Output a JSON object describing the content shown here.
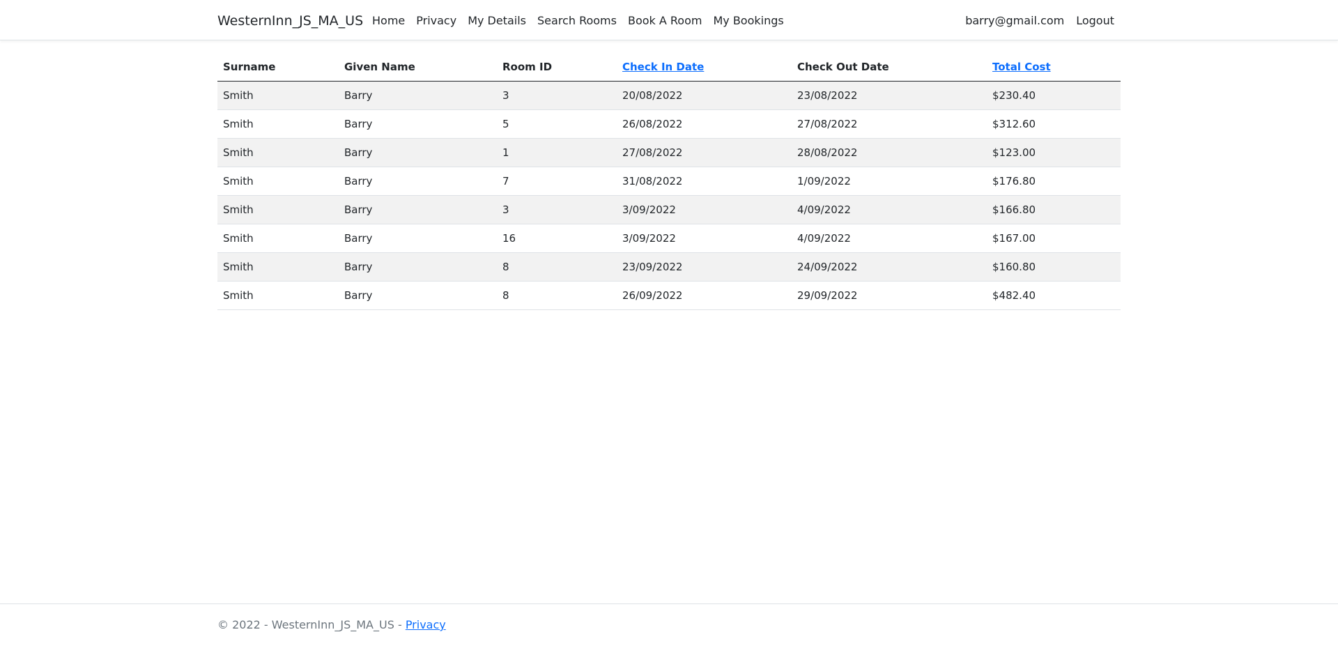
{
  "nav": {
    "brand": "WesternInn_JS_MA_US",
    "links": [
      "Home",
      "Privacy",
      "My Details",
      "Search Rooms",
      "Book A Room",
      "My Bookings"
    ],
    "user_email": "barry@gmail.com",
    "logout": "Logout"
  },
  "table": {
    "headers": [
      "Surname",
      "Given Name",
      "Room ID",
      "Check In Date",
      "Check Out Date",
      "Total Cost"
    ],
    "rows": [
      [
        "Smith",
        "Barry",
        "3",
        "20/08/2022",
        "23/08/2022",
        "$230.40"
      ],
      [
        "Smith",
        "Barry",
        "5",
        "26/08/2022",
        "27/08/2022",
        "$312.60"
      ],
      [
        "Smith",
        "Barry",
        "1",
        "27/08/2022",
        "28/08/2022",
        "$123.00"
      ],
      [
        "Smith",
        "Barry",
        "7",
        "31/08/2022",
        "1/09/2022",
        "$176.80"
      ],
      [
        "Smith",
        "Barry",
        "3",
        "3/09/2022",
        "4/09/2022",
        "$166.80"
      ],
      [
        "Smith",
        "Barry",
        "16",
        "3/09/2022",
        "4/09/2022",
        "$167.00"
      ],
      [
        "Smith",
        "Barry",
        "8",
        "23/09/2022",
        "24/09/2022",
        "$160.80"
      ],
      [
        "Smith",
        "Barry",
        "8",
        "26/09/2022",
        "29/09/2022",
        "$482.40"
      ]
    ]
  },
  "footer": {
    "text": "© 2022 - WesternInn_JS_MA_US - ",
    "privacy": "Privacy"
  },
  "colors": {
    "link": "#0d6efd",
    "stripe": "#f2f2f2",
    "muted": "#6c757d"
  }
}
